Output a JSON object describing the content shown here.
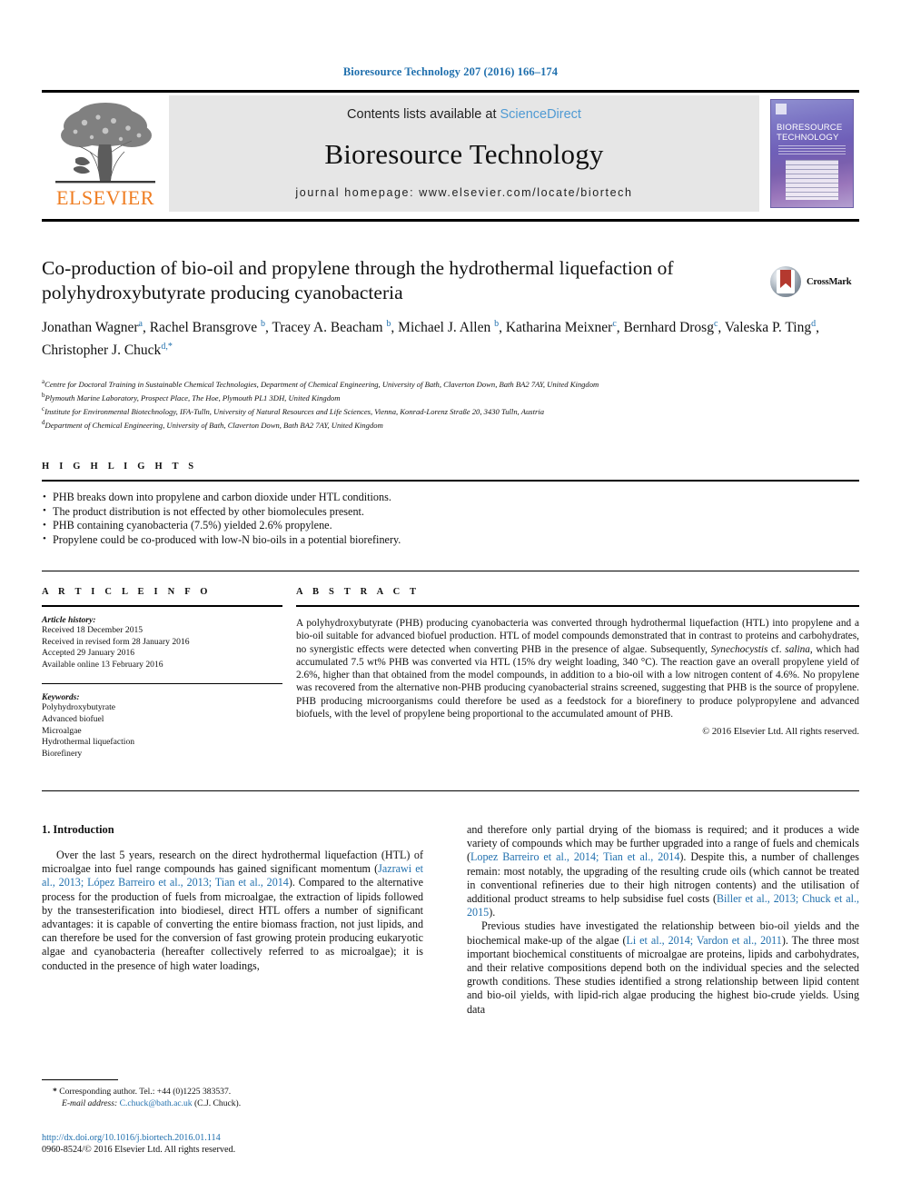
{
  "running_head": "Bioresource Technology 207 (2016) 166–174",
  "masthead": {
    "contents_prefix": "Contents lists available at ",
    "sciencedirect": "ScienceDirect",
    "journal_name": "Bioresource Technology",
    "homepage": "journal homepage: www.elsevier.com/locate/biortech",
    "publisher": "ELSEVIER",
    "cover_title_line1": "BIORESOURCE",
    "cover_title_line2": "TECHNOLOGY"
  },
  "article": {
    "title": "Co-production of bio-oil and propylene through the hydrothermal liquefaction of polyhydroxybutyrate producing cyanobacteria",
    "crossmark_label": "CrossMark",
    "authors_html": "Jonathan Wagner<sup>a</sup>, Rachel Bransgrove <sup>b</sup>, Tracey A. Beacham <sup>b</sup>, Michael J. Allen <sup>b</sup>, Katharina Meixner<sup>c</sup>, Bernhard Drosg<sup>c</sup>, Valeska P. Ting<sup>d</sup>, Christopher J. Chuck<sup>d,*</sup>",
    "affiliations": [
      {
        "marker": "a",
        "text": "Centre for Doctoral Training in Sustainable Chemical Technologies, Department of Chemical Engineering, University of Bath, Claverton Down, Bath BA2 7AY, United Kingdom"
      },
      {
        "marker": "b",
        "text": "Plymouth Marine Laboratory, Prospect Place, The Hoe, Plymouth PL1 3DH, United Kingdom"
      },
      {
        "marker": "c",
        "text": "Institute for Environmental Biotechnology, IFA-Tulln, University of Natural Resources and Life Sciences, Vienna, Konrad-Lorenz Straße 20, 3430 Tulln, Austria"
      },
      {
        "marker": "d",
        "text": "Department of Chemical Engineering, University of Bath, Claverton Down, Bath BA2 7AY, United Kingdom"
      }
    ]
  },
  "highlights": {
    "heading": "H I G H L I G H T S",
    "items": [
      "PHB breaks down into propylene and carbon dioxide under HTL conditions.",
      "The product distribution is not effected by other biomolecules present.",
      "PHB containing cyanobacteria (7.5%) yielded 2.6% propylene.",
      "Propylene could be co-produced with low-N bio-oils in a potential biorefinery."
    ]
  },
  "article_info": {
    "heading": "A R T I C L E   I N F O",
    "history_label": "Article history:",
    "history": [
      "Received 18 December 2015",
      "Received in revised form 28 January 2016",
      "Accepted 29 January 2016",
      "Available online 13 February 2016"
    ],
    "keywords_label": "Keywords:",
    "keywords": [
      "Polyhydroxybutyrate",
      "Advanced biofuel",
      "Microalgae",
      "Hydrothermal liquefaction",
      "Biorefinery"
    ]
  },
  "abstract": {
    "heading": "A B S T R A C T",
    "body_html": "A polyhydroxybutyrate (PHB) producing cyanobacteria was converted through hydrothermal liquefaction (HTL) into propylene and a bio-oil suitable for advanced biofuel production. HTL of model compounds demonstrated that in contrast to proteins and carbohydrates, no synergistic effects were detected when converting PHB in the presence of algae. Subsequently, <i>Synechocystis</i> cf. <i>salina</i>, which had accumulated 7.5 wt% PHB was converted via HTL (15% dry weight loading, 340 &#176;C). The reaction gave an overall propylene yield of 2.6%, higher than that obtained from the model compounds, in addition to a bio-oil with a low nitrogen content of 4.6%. No propylene was recovered from the alternative non-PHB producing cyanobacterial strains screened, suggesting that PHB is the source of propylene. PHB producing microorganisms could therefore be used as a feedstock for a biorefinery to produce polypropylene and advanced biofuels, with the level of propylene being proportional to the accumulated amount of PHB.",
    "copyright": "© 2016 Elsevier Ltd. All rights reserved."
  },
  "introduction": {
    "heading": "1. Introduction",
    "left_html": "Over the last 5 years, research on the direct hydrothermal liquefaction (HTL) of microalgae into fuel range compounds has gained significant momentum (<span class=\"cite\">Jazrawi et al., 2013; L&#243;pez Barreiro et al., 2013; Tian et al., 2014</span>). Compared to the alternative process for the production of fuels from microalgae, the extraction of lipids followed by the transesterification into biodiesel, direct HTL offers a number of significant advantages: it is capable of converting the entire biomass fraction, not just lipids, and can therefore be used for the conversion of fast growing protein producing eukaryotic algae and cyanobacteria (hereafter collectively referred to as microalgae); it is conducted in the presence of high water loadings,",
    "right_html_1": "and therefore only partial drying of the biomass is required; and it produces a wide variety of compounds which may be further upgraded into a range of fuels and chemicals (<span class=\"cite\">Lopez Barreiro et al., 2014; Tian et al., 2014</span>). Despite this, a number of challenges remain: most notably, the upgrading of the resulting crude oils (which cannot be treated in conventional refineries due to their high nitrogen contents) and the utilisation of additional product streams to help subsidise fuel costs (<span class=\"cite\">Biller et al., 2013; Chuck et al., 2015</span>).",
    "right_html_2": "Previous studies have investigated the relationship between bio-oil yields and the biochemical make-up of the algae (<span class=\"cite\">Li et al., 2014; Vardon et al., 2011</span>). The three most important biochemical constituents of microalgae are proteins, lipids and carbohydrates, and their relative compositions depend both on the individual species and the selected growth conditions. These studies identified a strong relationship between lipid content and bio-oil yields, with lipid-rich algae producing the highest bio-crude yields. Using data"
  },
  "footer": {
    "corresponding_html": "<b>*</b> Corresponding author. Tel.: +44 (0)1225 383537.",
    "email_html": "<i>E-mail address:</i> <span class=\"cite\">C.chuck@bath.ac.uk</span> (C.J. Chuck).",
    "doi": "http://dx.doi.org/10.1016/j.biortech.2016.01.114",
    "issn": "0960-8524/© 2016 Elsevier Ltd. All rights reserved."
  },
  "colors": {
    "link": "#1f6fad",
    "sciencedirect": "#4f9ad3",
    "elsevier_orange": "#ef7d22",
    "masthead_bg": "#e6e6e6"
  }
}
